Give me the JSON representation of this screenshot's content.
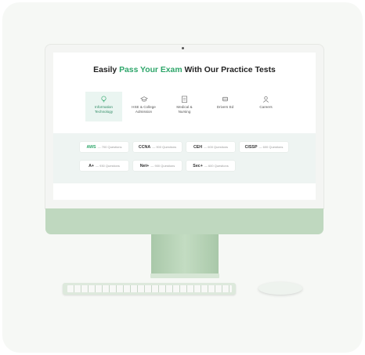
{
  "headline": {
    "part1": "Easily ",
    "highlight": "Pass Your Exam",
    "part2": " With Our Practice Tests"
  },
  "categories": [
    {
      "line1": "Information",
      "line2": "Technology",
      "icon": "cloud-bulb-icon",
      "active": true
    },
    {
      "line1": "HSE & College",
      "line2": "Admission",
      "icon": "graduation-cap-icon",
      "active": false
    },
    {
      "line1": "Medical &",
      "line2": "Nursing",
      "icon": "clipboard-icon",
      "active": false
    },
    {
      "line1": "Drivers Ed",
      "line2": "",
      "icon": "car-icon",
      "active": false
    },
    {
      "line1": "Careers",
      "line2": "",
      "icon": "person-icon",
      "active": false
    }
  ],
  "exams": [
    {
      "name": "AWS",
      "questions": "— 700 Questions"
    },
    {
      "name": "CCNA",
      "questions": "— 900 Questions"
    },
    {
      "name": "CEH",
      "questions": "— 600 Questions"
    },
    {
      "name": "CISSP",
      "questions": "— 600 Questions"
    },
    {
      "name": "A+",
      "questions": "— 930 Questions"
    },
    {
      "name": "Net+",
      "questions": "— 900 Questions"
    },
    {
      "name": "Sec+",
      "questions": "— 600 Questions"
    }
  ],
  "colors": {
    "accent": "#2ea66a",
    "band": "#eef4f2",
    "monitor": "#bfd8bf"
  }
}
